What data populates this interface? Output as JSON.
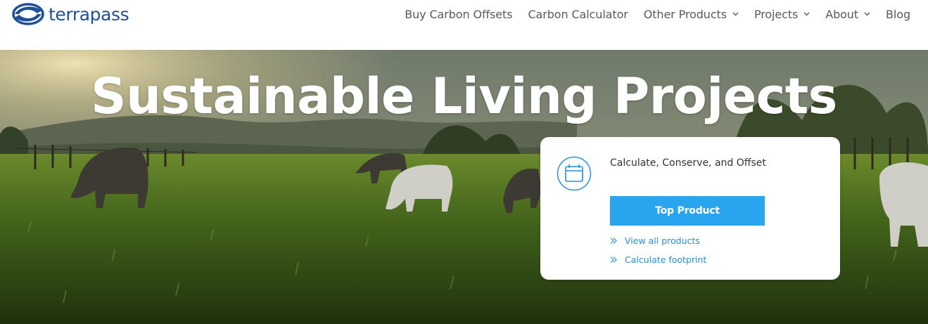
{
  "brand": {
    "name": "terrapass",
    "color": "#1f4f9a",
    "logo_icon": "terrapass-swirl-icon"
  },
  "nav": {
    "items": [
      {
        "label": "Buy Carbon Offsets",
        "has_dropdown": false
      },
      {
        "label": "Carbon Calculator",
        "has_dropdown": false
      },
      {
        "label": "Other Products",
        "has_dropdown": true
      },
      {
        "label": "Projects",
        "has_dropdown": true
      },
      {
        "label": "About",
        "has_dropdown": true
      },
      {
        "label": "Blog",
        "has_dropdown": false
      }
    ],
    "text_color": "#5a5a5a"
  },
  "hero": {
    "title": "Sustainable Living Projects",
    "background_image": "grazing-cattle-pasture-at-sunset",
    "card": {
      "icon": "calendar-icon",
      "heading": "Calculate, Conserve, and Offset",
      "cta_label": "Top Product",
      "cta_color": "#29a4ef",
      "links": [
        {
          "label": "View all products",
          "icon": "double-chevron-right-icon"
        },
        {
          "label": "Calculate footprint",
          "icon": "double-chevron-right-icon"
        }
      ]
    }
  }
}
